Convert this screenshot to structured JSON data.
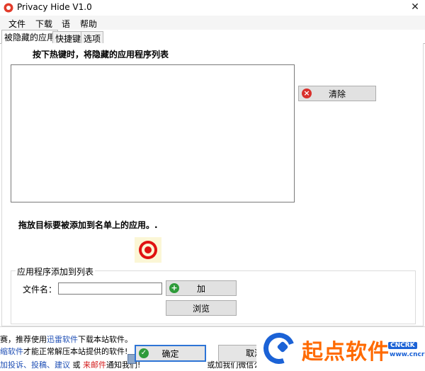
{
  "window": {
    "title": "Privacy Hide V1.0",
    "close_glyph": "✕"
  },
  "menu": [
    "文件",
    "下载",
    "语",
    "帮助"
  ],
  "tabs": [
    "被隐藏的应用",
    "快捷键",
    "选项"
  ],
  "panel": {
    "hotkey_label": "按下热键时，将隐藏的应用程序列表",
    "clear_button": "清除",
    "drag_label": "拖放目标要被添加到名单上的应用。.",
    "group_title": "应用程序添加到列表",
    "filename_label": "文件名：",
    "filename_value": "",
    "add_button": "加",
    "browse_button": "浏览"
  },
  "footer": {
    "line1": [
      "赛，推荐使用",
      "迅雷软件",
      "下载本站软件。"
    ],
    "line2": [
      "缩软件",
      "才能正常解压本站提供的软件!"
    ],
    "line3": [
      "加投诉",
      "、",
      "投稿",
      "、",
      "建议",
      " 或 ",
      "来邮件",
      "通知我们!",
      "或加我们微信公众号："
    ],
    "ok_button": "确定",
    "cancel_button": "取消"
  },
  "watermark": {
    "brand": "起点软件",
    "badge": "CNCRK",
    "url": "www.cncrk.com"
  },
  "colors": {
    "link_blue": "#1f4fb5",
    "link_red": "#d41a1a",
    "brand_orange": "#ff6a00",
    "brand_blue": "#1b62d6"
  }
}
